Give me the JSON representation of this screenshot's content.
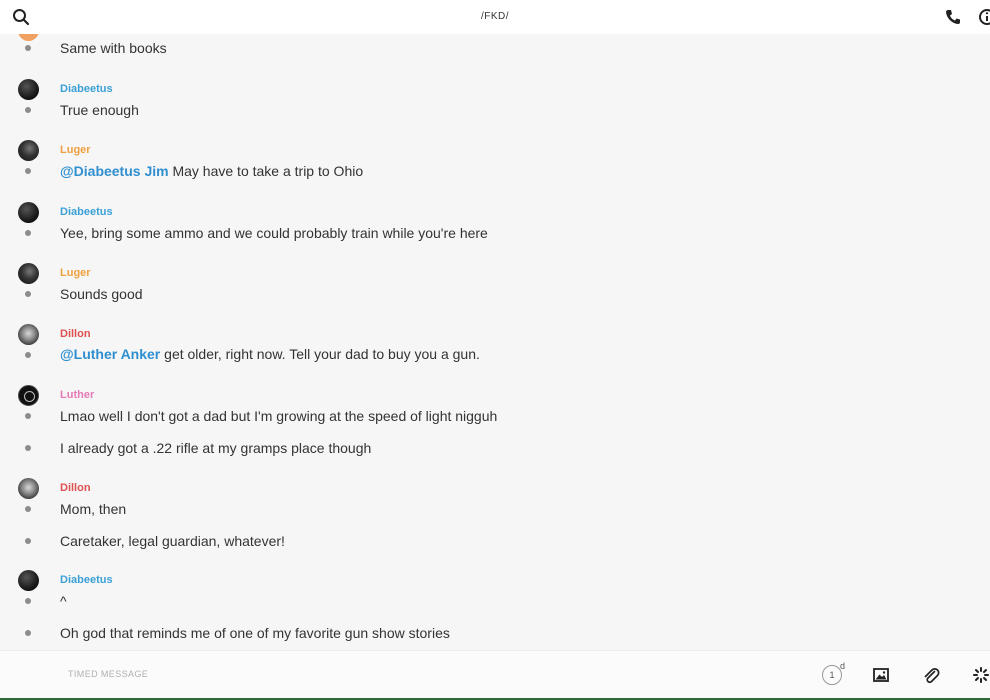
{
  "header": {
    "title": "/FKD/",
    "icons": {
      "search": "search-icon",
      "call": "phone-icon",
      "info": "info-icon"
    }
  },
  "colors": {
    "diabeetus": "#3ba0d6",
    "luger": "#f0a040",
    "dillon": "#e05050",
    "luther": "#e67ab6",
    "mention": "#2f8fd0"
  },
  "messages": [
    {
      "text": "Same with books"
    },
    {
      "author": "Diabeetus",
      "text": "True enough"
    },
    {
      "author": "Luger",
      "mention": "@Diabeetus Jim",
      "text": " May have to take a trip to Ohio"
    },
    {
      "author": "Diabeetus",
      "text": "Yee, bring some ammo and we could probably train while you're here"
    },
    {
      "author": "Luger",
      "text": "Sounds good"
    },
    {
      "author": "Dillon",
      "mention": "@Luther Anker",
      "text": " get older, right now. Tell your dad to buy you a gun."
    },
    {
      "author": "Luther",
      "text": "Lmao well I don't got a dad but I'm growing at the speed of light nigguh"
    },
    {
      "text": "I already got a .22 rifle at my gramps place though"
    },
    {
      "author": "Dillon",
      "text": "Mom, then"
    },
    {
      "text": "Caretaker, legal guardian, whatever!"
    },
    {
      "author": "Diabeetus",
      "text": "^"
    },
    {
      "text": "Oh god that reminds me of one of my favorite gun show stories"
    }
  ],
  "composer": {
    "placeholder": "TIMED MESSAGE",
    "timer_value": "1",
    "timer_unit": "d",
    "icons": {
      "image": "image-icon",
      "attach": "paperclip-icon",
      "more": "sparkle-icon"
    }
  }
}
